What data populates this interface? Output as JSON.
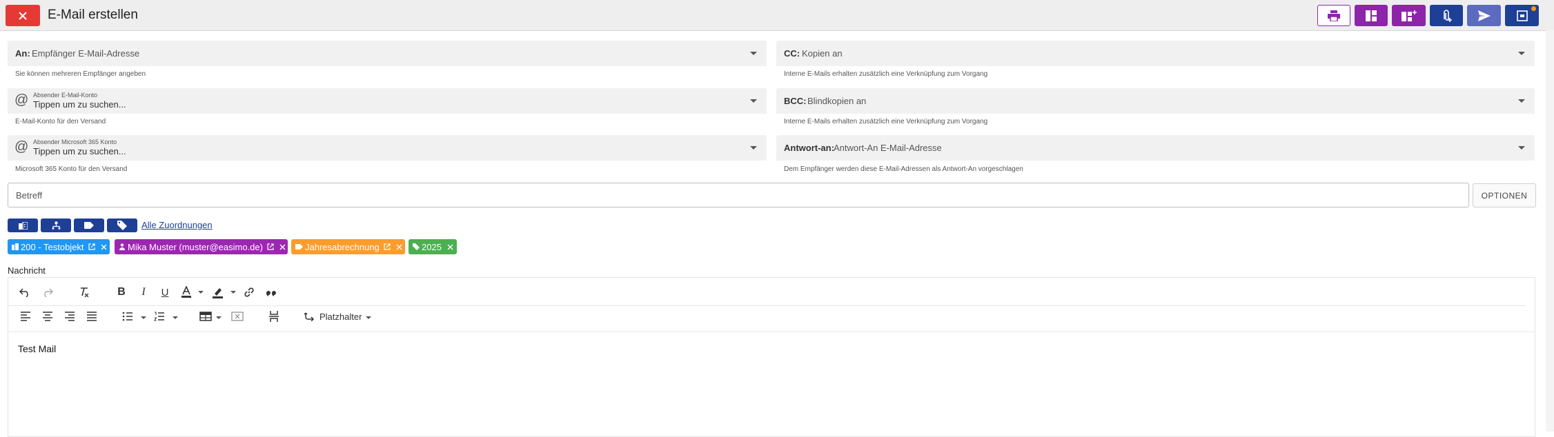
{
  "header": {
    "title": "E-Mail erstellen",
    "colors": {
      "close": "#e53935",
      "purple": "#8e24aa",
      "blue": "#1e3f96",
      "gray_blue": "#5c6bc0"
    }
  },
  "fields": {
    "to": {
      "label": "An:",
      "placeholder": "Empfänger E-Mail-Adresse",
      "hint": "Sie können mehreren Empfänger angeben"
    },
    "cc": {
      "label": "CC:",
      "placeholder": "Kopien an",
      "hint": "Interne E-Mails erhalten zusätzlich eine Verknüpfung zum Vorgang"
    },
    "sender": {
      "small_label": "Absender E-Mail-Konto",
      "placeholder": "Tippen um zu suchen...",
      "hint": "E-Mail-Konto für den Versand"
    },
    "bcc": {
      "label": "BCC:",
      "placeholder": "Blindkopien an",
      "hint": "Interne E-Mails erhalten zusätzlich eine Verknüpfung zum Vorgang"
    },
    "ms365": {
      "small_label": "Absender Microsoft 365 Konto",
      "placeholder": "Tippen um zu suchen...",
      "hint": "Microsoft 365 Konto für den Versand"
    },
    "reply_to": {
      "label": "Antwort-an:",
      "placeholder": "Antwort-An E-Mail-Adresse",
      "hint": "Dem Empfänger werden diese E-Mail-Adressen als Antwort-An vorgeschlagen"
    },
    "subject": {
      "placeholder": "Betreff"
    },
    "options_label": "OPTIONEN"
  },
  "assignments": {
    "all_link": "Alle Zuordnungen",
    "chips": [
      {
        "label": "200 - Testobjekt",
        "color": "#2196f3",
        "icon": "building-icon"
      },
      {
        "label": "Mika Muster (muster@easimo.de)",
        "color": "#9c27b0",
        "icon": "person-icon"
      },
      {
        "label": "Jahresabrechnung",
        "color": "#fb9c2c",
        "icon": "label-icon"
      },
      {
        "label": "2025",
        "color": "#4caf50",
        "icon": "tags-icon"
      }
    ]
  },
  "editor": {
    "label": "Nachricht",
    "placeholder_menu": "Platzhalter",
    "content": "Test Mail"
  }
}
